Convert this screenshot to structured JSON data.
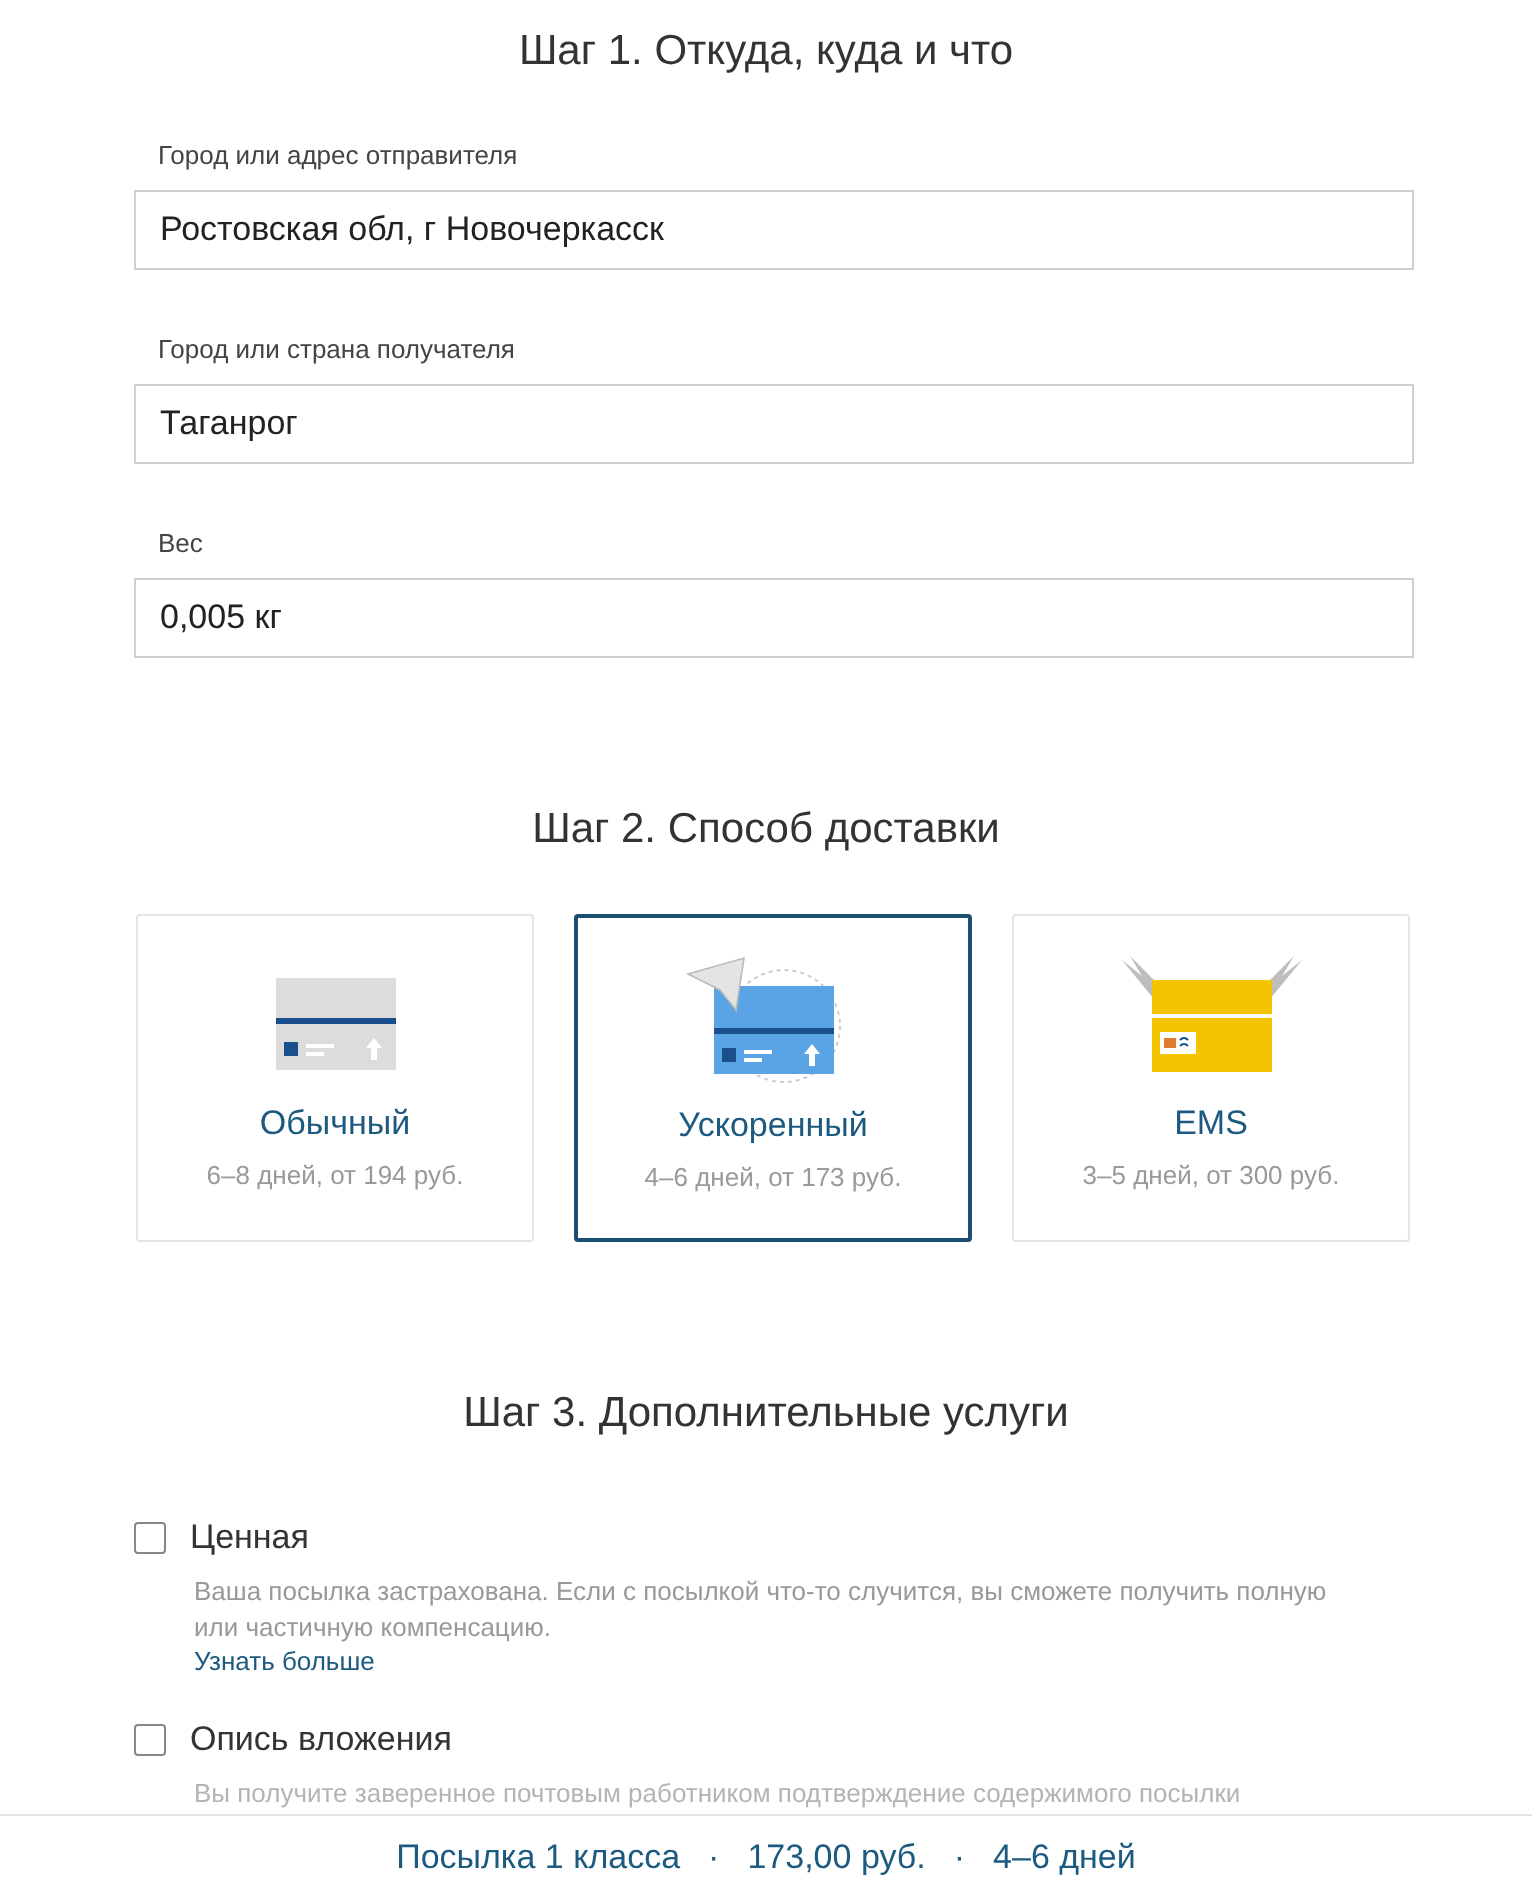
{
  "step1": {
    "title": "Шаг 1. Откуда, куда и что",
    "fields": [
      {
        "label": "Город или адрес отправителя",
        "value": "Ростовская обл, г Новочеркасск"
      },
      {
        "label": "Город или страна получателя",
        "value": "Таганрог"
      },
      {
        "label": "Вес",
        "value": "0,005 кг"
      }
    ]
  },
  "step2": {
    "title": "Шаг 2. Способ доставки",
    "methods": [
      {
        "kind": "regular",
        "name": "Обычный",
        "details": "6–8 дней, от 194 руб.",
        "selected": false
      },
      {
        "kind": "express",
        "name": "Ускоренный",
        "details": "4–6 дней, от 173 руб.",
        "selected": true
      },
      {
        "kind": "ems",
        "name": "EMS",
        "details": "3–5 дней, от 300 руб.",
        "selected": false
      }
    ]
  },
  "step3": {
    "title": "Шаг 3. Дополнительные услуги",
    "services": [
      {
        "name": "Ценная",
        "checked": false,
        "description": "Ваша посылка застрахована. Если с посылкой что-то случится, вы сможете получить полную или частичную компенсацию.",
        "link": "Узнать больше"
      },
      {
        "name": "Опись вложения",
        "checked": false,
        "description": "Вы получите заверенное почтовым работником подтверждение содержимого посылки"
      }
    ]
  },
  "summary": {
    "separator": "·",
    "items": [
      "Посылка 1 класса",
      "173,00 руб.",
      "4–6 дней"
    ]
  }
}
